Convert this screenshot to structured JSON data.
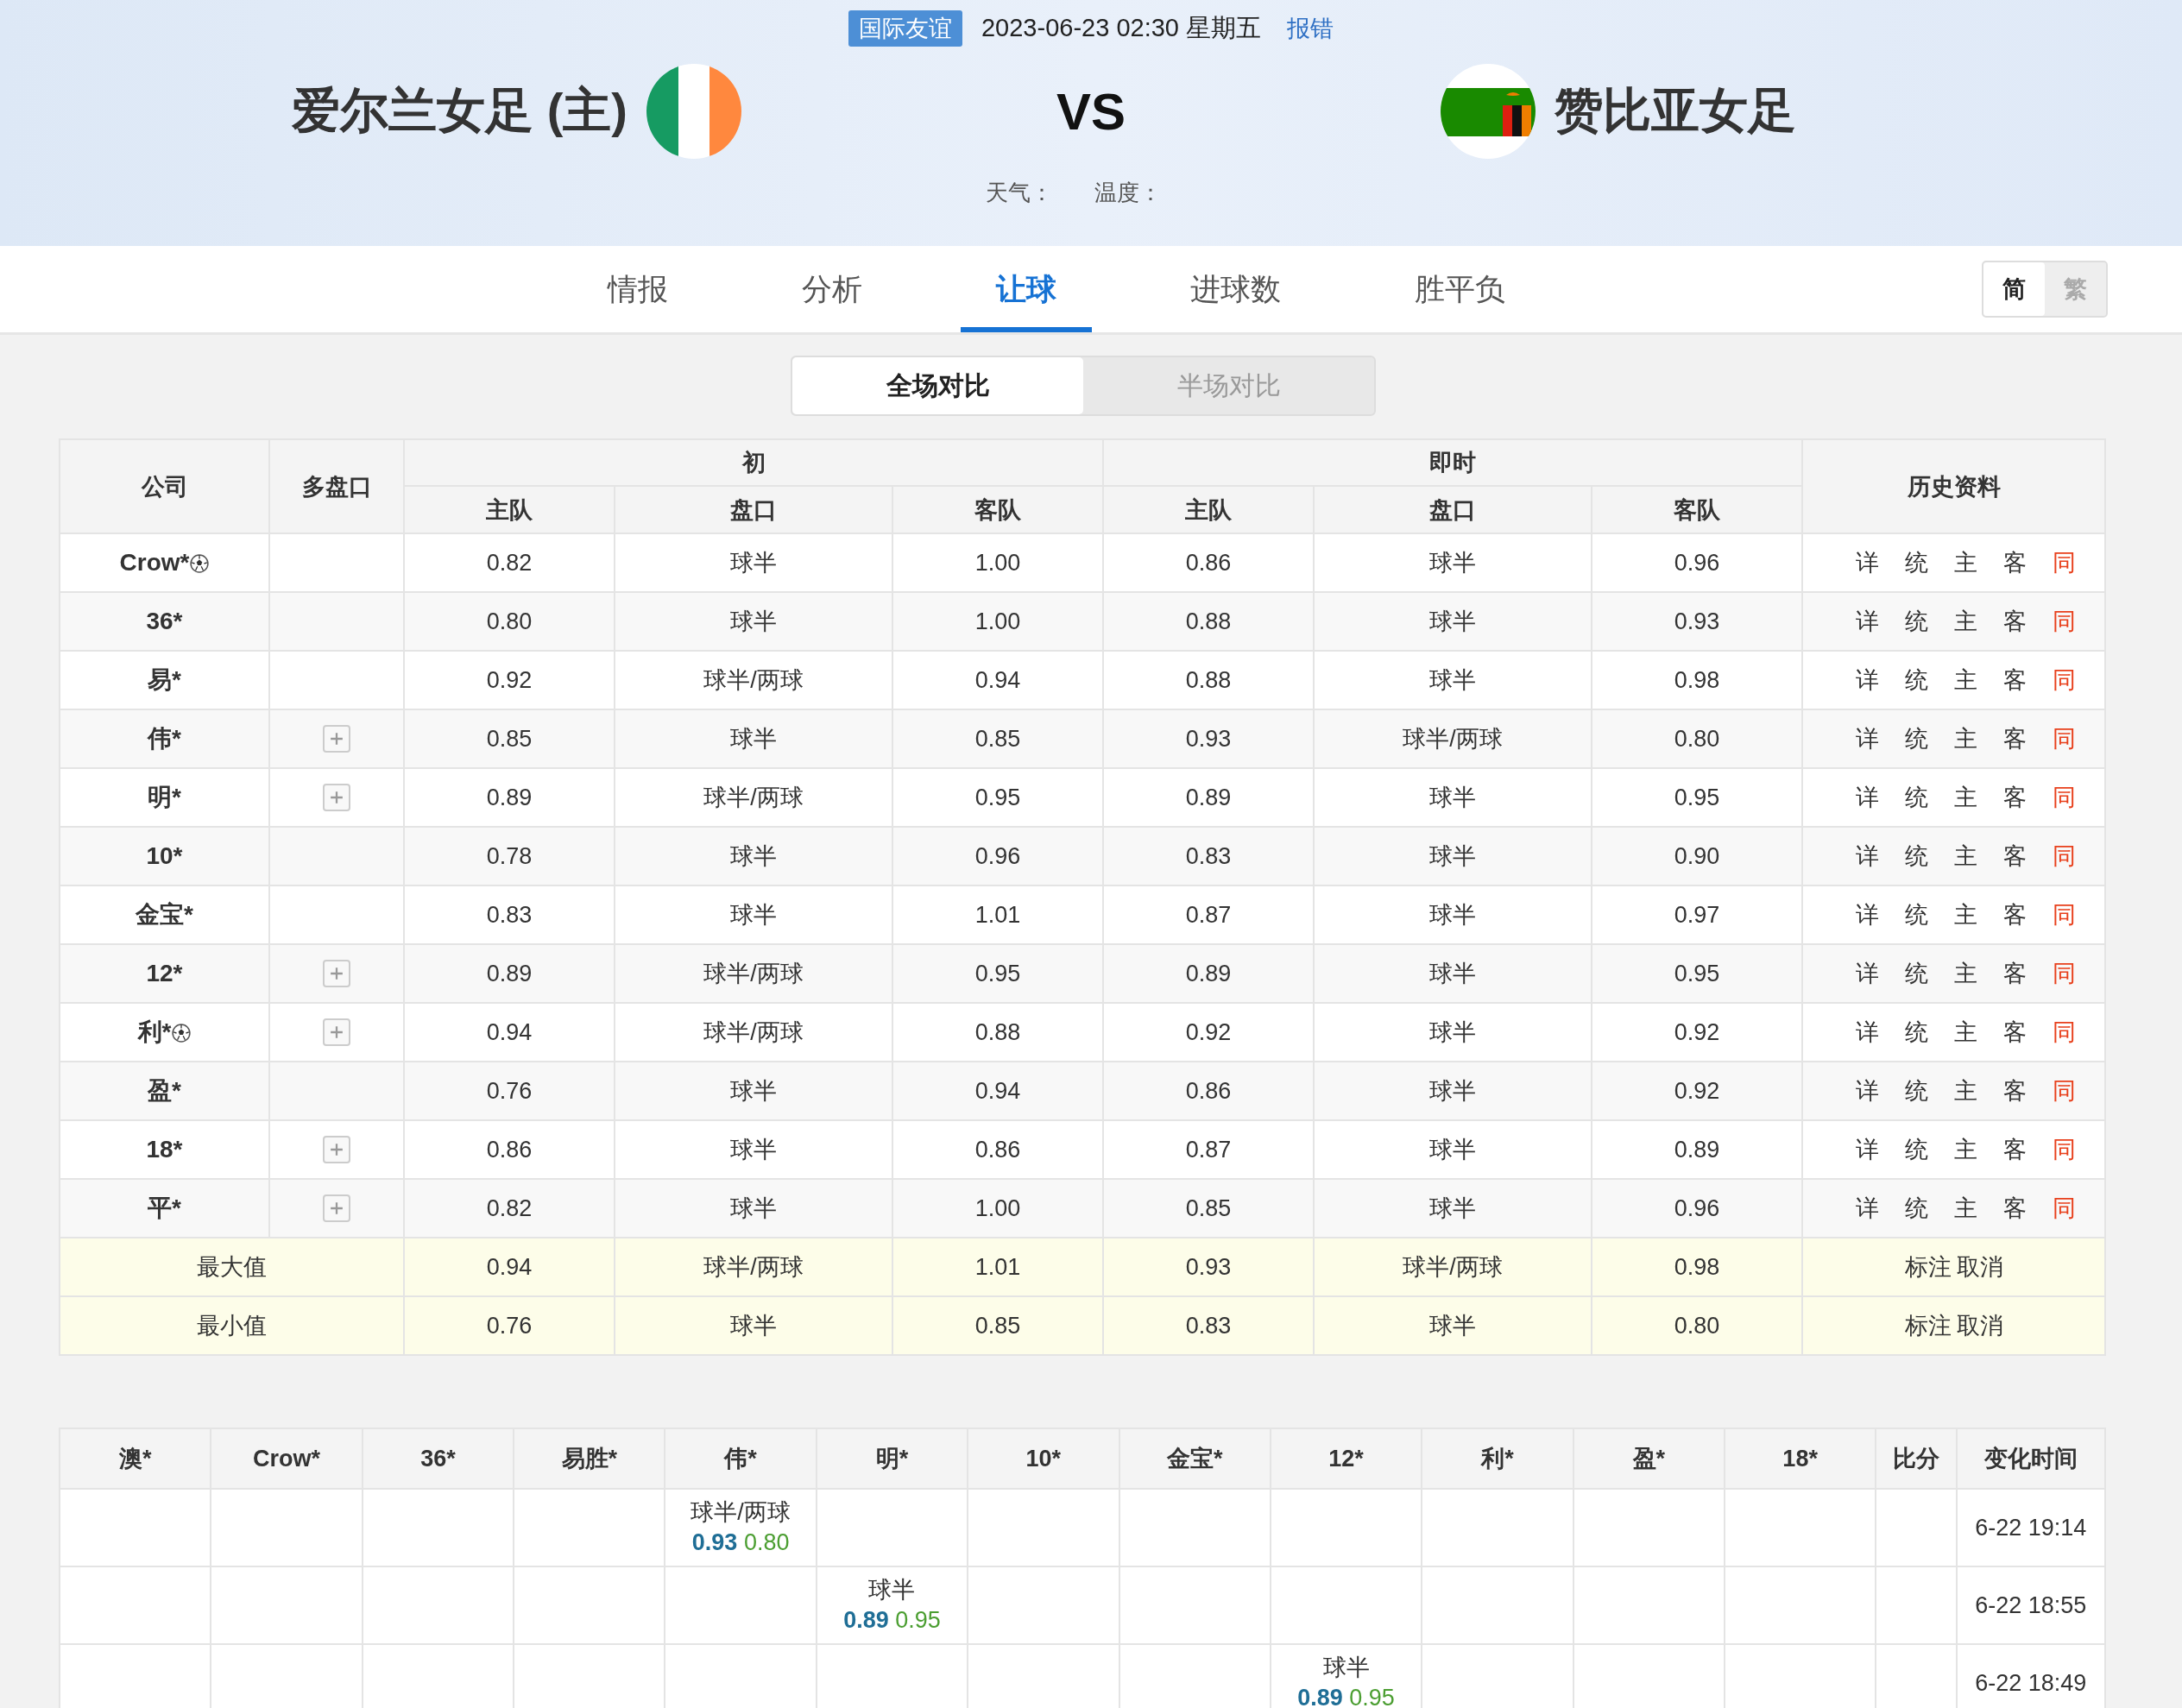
{
  "match": {
    "competition": "国际友谊",
    "datetime": "2023-06-23 02:30 星期五",
    "report": "报错",
    "home": "爱尔兰女足 (主)",
    "vs": "VS",
    "away": "赞比亚女足",
    "weather": "天气：",
    "temperature": "温度："
  },
  "tabs": [
    {
      "label": "情报",
      "selected": false
    },
    {
      "label": "分析",
      "selected": false
    },
    {
      "label": "让球",
      "selected": true
    },
    {
      "label": "进球数",
      "selected": false
    },
    {
      "label": "胜平负",
      "selected": false
    }
  ],
  "language": [
    {
      "label": "简",
      "selected": true
    },
    {
      "label": "繁",
      "selected": false
    }
  ],
  "compare": [
    {
      "label": "全场对比",
      "selected": true
    },
    {
      "label": "半场对比",
      "selected": false
    }
  ],
  "odds_table": {
    "headers": {
      "company": "公司",
      "multi": "多盘口",
      "initial": "初",
      "live": "即时",
      "history": "历史资料",
      "sub": [
        "主队",
        "盘口",
        "客队",
        "主队",
        "盘口",
        "客队"
      ]
    },
    "rows": [
      {
        "company": "Crow*",
        "ball": true,
        "multi": false,
        "initial": [
          "0.82",
          "球半",
          "1.00"
        ],
        "live": [
          "0.86",
          "球半",
          "0.96"
        ],
        "history": [
          "详",
          "统",
          "主",
          "客",
          "同"
        ]
      },
      {
        "company": "36*",
        "ball": false,
        "multi": false,
        "initial": [
          "0.80",
          "球半",
          "1.00"
        ],
        "live": [
          "0.88",
          "球半",
          "0.93"
        ],
        "history": [
          "详",
          "统",
          "主",
          "客",
          "同"
        ]
      },
      {
        "company": "易*",
        "ball": false,
        "multi": false,
        "initial": [
          "0.92",
          "球半/两球",
          "0.94"
        ],
        "live": [
          "0.88",
          "球半",
          "0.98"
        ],
        "history": [
          "详",
          "统",
          "主",
          "客",
          "同"
        ]
      },
      {
        "company": "伟*",
        "ball": false,
        "multi": true,
        "initial": [
          "0.85",
          "球半",
          "0.85"
        ],
        "live": [
          "0.93",
          "球半/两球",
          "0.80"
        ],
        "history": [
          "详",
          "统",
          "主",
          "客",
          "同"
        ]
      },
      {
        "company": "明*",
        "ball": false,
        "multi": true,
        "initial": [
          "0.89",
          "球半/两球",
          "0.95"
        ],
        "live": [
          "0.89",
          "球半",
          "0.95"
        ],
        "history": [
          "详",
          "统",
          "主",
          "客",
          "同"
        ]
      },
      {
        "company": "10*",
        "ball": false,
        "multi": false,
        "initial": [
          "0.78",
          "球半",
          "0.96"
        ],
        "live": [
          "0.83",
          "球半",
          "0.90"
        ],
        "history": [
          "详",
          "统",
          "主",
          "客",
          "同"
        ]
      },
      {
        "company": "金宝*",
        "ball": false,
        "multi": false,
        "initial": [
          "0.83",
          "球半",
          "1.01"
        ],
        "live": [
          "0.87",
          "球半",
          "0.97"
        ],
        "history": [
          "详",
          "统",
          "主",
          "客",
          "同"
        ]
      },
      {
        "company": "12*",
        "ball": false,
        "multi": true,
        "initial": [
          "0.89",
          "球半/两球",
          "0.95"
        ],
        "live": [
          "0.89",
          "球半",
          "0.95"
        ],
        "history": [
          "详",
          "统",
          "主",
          "客",
          "同"
        ]
      },
      {
        "company": "利*",
        "ball": true,
        "multi": true,
        "initial": [
          "0.94",
          "球半/两球",
          "0.88"
        ],
        "live": [
          "0.92",
          "球半",
          "0.92"
        ],
        "history": [
          "详",
          "统",
          "主",
          "客",
          "同"
        ]
      },
      {
        "company": "盈*",
        "ball": false,
        "multi": false,
        "initial": [
          "0.76",
          "球半",
          "0.94"
        ],
        "live": [
          "0.86",
          "球半",
          "0.92"
        ],
        "history": [
          "详",
          "统",
          "主",
          "客",
          "同"
        ]
      },
      {
        "company": "18*",
        "ball": false,
        "multi": true,
        "initial": [
          "0.86",
          "球半",
          "0.86"
        ],
        "live": [
          "0.87",
          "球半",
          "0.89"
        ],
        "history": [
          "详",
          "统",
          "主",
          "客",
          "同"
        ]
      },
      {
        "company": "平*",
        "ball": false,
        "multi": true,
        "initial": [
          "0.82",
          "球半",
          "1.00"
        ],
        "live": [
          "0.85",
          "球半",
          "0.96"
        ],
        "history": [
          "详",
          "统",
          "主",
          "客",
          "同"
        ]
      }
    ],
    "summary": [
      {
        "label": "最大值",
        "initial": [
          "0.94",
          "球半/两球",
          "1.01"
        ],
        "live": [
          "0.93",
          "球半/两球",
          "0.98"
        ],
        "actions": [
          "标注",
          "取消"
        ]
      },
      {
        "label": "最小值",
        "initial": [
          "0.76",
          "球半",
          "0.85"
        ],
        "live": [
          "0.83",
          "球半",
          "0.80"
        ],
        "actions": [
          "标注",
          "取消"
        ]
      }
    ]
  },
  "changes_table": {
    "columns": [
      "澳*",
      "Crow*",
      "36*",
      "易胜*",
      "伟*",
      "明*",
      "10*",
      "金宝*",
      "12*",
      "利*",
      "盈*",
      "18*",
      "比分",
      "变化时间"
    ],
    "rows": [
      {
        "cells": [
          {},
          {},
          {},
          {},
          {
            "line": "球半/两球",
            "home": "0.93",
            "away": "0.80"
          },
          {},
          {},
          {},
          {},
          {},
          {},
          {},
          {}
        ],
        "time": "6-22 19:14"
      },
      {
        "cells": [
          {},
          {},
          {},
          {},
          {},
          {
            "line": "球半",
            "home": "0.89",
            "away": "0.95"
          },
          {},
          {},
          {},
          {},
          {},
          {},
          {}
        ],
        "time": "6-22 18:55"
      },
      {
        "cells": [
          {},
          {},
          {},
          {},
          {},
          {},
          {},
          {},
          {
            "line": "球半",
            "home": "0.89",
            "away": "0.95"
          },
          {},
          {},
          {},
          {}
        ],
        "time": "6-22 18:49"
      }
    ]
  }
}
